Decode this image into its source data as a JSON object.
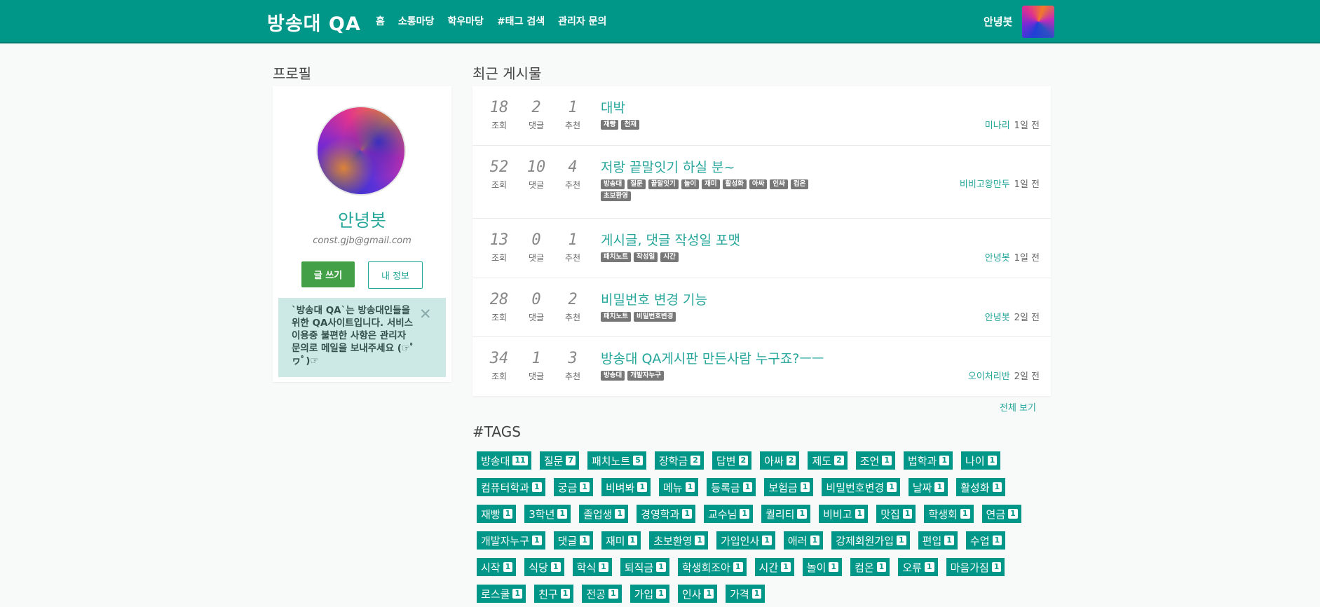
{
  "nav": {
    "brand": "방송대 QA",
    "links": [
      "홈",
      "소통마당",
      "학우마당",
      "#태그 검색",
      "관리자 문의"
    ],
    "user": "안녕봇"
  },
  "profile": {
    "title": "프로필",
    "name": "안녕봇",
    "email": "const.gjb@gmail.com",
    "write_label": "글 쓰기",
    "info_label": "내 정보",
    "notice": "`방송대 QA`는 방송대인들을 위한 QA사이트입니다. 서비스 이용중 불편한 사항은 관리자 문의로 메일을 보내주세요 (☞ﾟヮﾟ)☞"
  },
  "posts": {
    "title": "최근 게시물",
    "stat_labels": [
      "조회",
      "댓글",
      "추천"
    ],
    "items": [
      {
        "views": "18",
        "comments": "2",
        "likes": "1",
        "title": "대박",
        "tags": [
          "재빵",
          "천재"
        ],
        "author": "미나리",
        "time": "1일 전"
      },
      {
        "views": "52",
        "comments": "10",
        "likes": "4",
        "title": "저랑 끝말잇기 하실 분~",
        "tags": [
          "방송대",
          "질문",
          "끝말잇기",
          "놀이",
          "재미",
          "활성화",
          "아싸",
          "인싸",
          "컴온",
          "초보환영"
        ],
        "author": "비비고왕만두",
        "time": "1일 전"
      },
      {
        "views": "13",
        "comments": "0",
        "likes": "1",
        "title": "게시글, 댓글 작성일 포맷",
        "tags": [
          "패치노트",
          "작성일",
          "시간"
        ],
        "author": "안녕봇",
        "time": "1일 전"
      },
      {
        "views": "28",
        "comments": "0",
        "likes": "2",
        "title": "비밀번호 변경 기능",
        "tags": [
          "패치노트",
          "비밀번호변경"
        ],
        "author": "안녕봇",
        "time": "2일 전"
      },
      {
        "views": "34",
        "comments": "1",
        "likes": "3",
        "title": "방송대 QA게시판 만든사람 누구죠?ㅡㅡ",
        "tags": [
          "방송대",
          "개발자누구"
        ],
        "author": "오이처리반",
        "time": "2일 전"
      }
    ],
    "see_all": "전체 보기"
  },
  "tags": {
    "title": "#TAGS",
    "items": [
      {
        "name": "방송대",
        "count": "11"
      },
      {
        "name": "질문",
        "count": "7"
      },
      {
        "name": "패치노트",
        "count": "5"
      },
      {
        "name": "장학금",
        "count": "2"
      },
      {
        "name": "답변",
        "count": "2"
      },
      {
        "name": "아싸",
        "count": "2"
      },
      {
        "name": "제도",
        "count": "2"
      },
      {
        "name": "조언",
        "count": "1"
      },
      {
        "name": "법학과",
        "count": "1"
      },
      {
        "name": "나이",
        "count": "1"
      },
      {
        "name": "컴퓨터학과",
        "count": "1"
      },
      {
        "name": "궁금",
        "count": "1"
      },
      {
        "name": "비벼봐",
        "count": "1"
      },
      {
        "name": "메뉴",
        "count": "1"
      },
      {
        "name": "등록금",
        "count": "1"
      },
      {
        "name": "보험금",
        "count": "1"
      },
      {
        "name": "비밀번호변경",
        "count": "1"
      },
      {
        "name": "날짜",
        "count": "1"
      },
      {
        "name": "활성화",
        "count": "1"
      },
      {
        "name": "재빵",
        "count": "1"
      },
      {
        "name": "3학년",
        "count": "1"
      },
      {
        "name": "졸업생",
        "count": "1"
      },
      {
        "name": "경영학과",
        "count": "1"
      },
      {
        "name": "교수님",
        "count": "1"
      },
      {
        "name": "퀄리티",
        "count": "1"
      },
      {
        "name": "비비고",
        "count": "1"
      },
      {
        "name": "맛집",
        "count": "1"
      },
      {
        "name": "학생회",
        "count": "1"
      },
      {
        "name": "연금",
        "count": "1"
      },
      {
        "name": "개발자누구",
        "count": "1"
      },
      {
        "name": "댓글",
        "count": "1"
      },
      {
        "name": "재미",
        "count": "1"
      },
      {
        "name": "초보환영",
        "count": "1"
      },
      {
        "name": "가입인사",
        "count": "1"
      },
      {
        "name": "애러",
        "count": "1"
      },
      {
        "name": "강제회원가입",
        "count": "1"
      },
      {
        "name": "편입",
        "count": "1"
      },
      {
        "name": "수업",
        "count": "1"
      },
      {
        "name": "시작",
        "count": "1"
      },
      {
        "name": "식당",
        "count": "1"
      },
      {
        "name": "학식",
        "count": "1"
      },
      {
        "name": "퇴직금",
        "count": "1"
      },
      {
        "name": "학생회조아",
        "count": "1"
      },
      {
        "name": "시간",
        "count": "1"
      },
      {
        "name": "놀이",
        "count": "1"
      },
      {
        "name": "컴온",
        "count": "1"
      },
      {
        "name": "오류",
        "count": "1"
      },
      {
        "name": "마음가짐",
        "count": "1"
      },
      {
        "name": "로스쿨",
        "count": "1"
      },
      {
        "name": "친구",
        "count": "1"
      },
      {
        "name": "전공",
        "count": "1"
      },
      {
        "name": "가입",
        "count": "1"
      },
      {
        "name": "인사",
        "count": "1"
      },
      {
        "name": "가격",
        "count": "1"
      }
    ]
  }
}
